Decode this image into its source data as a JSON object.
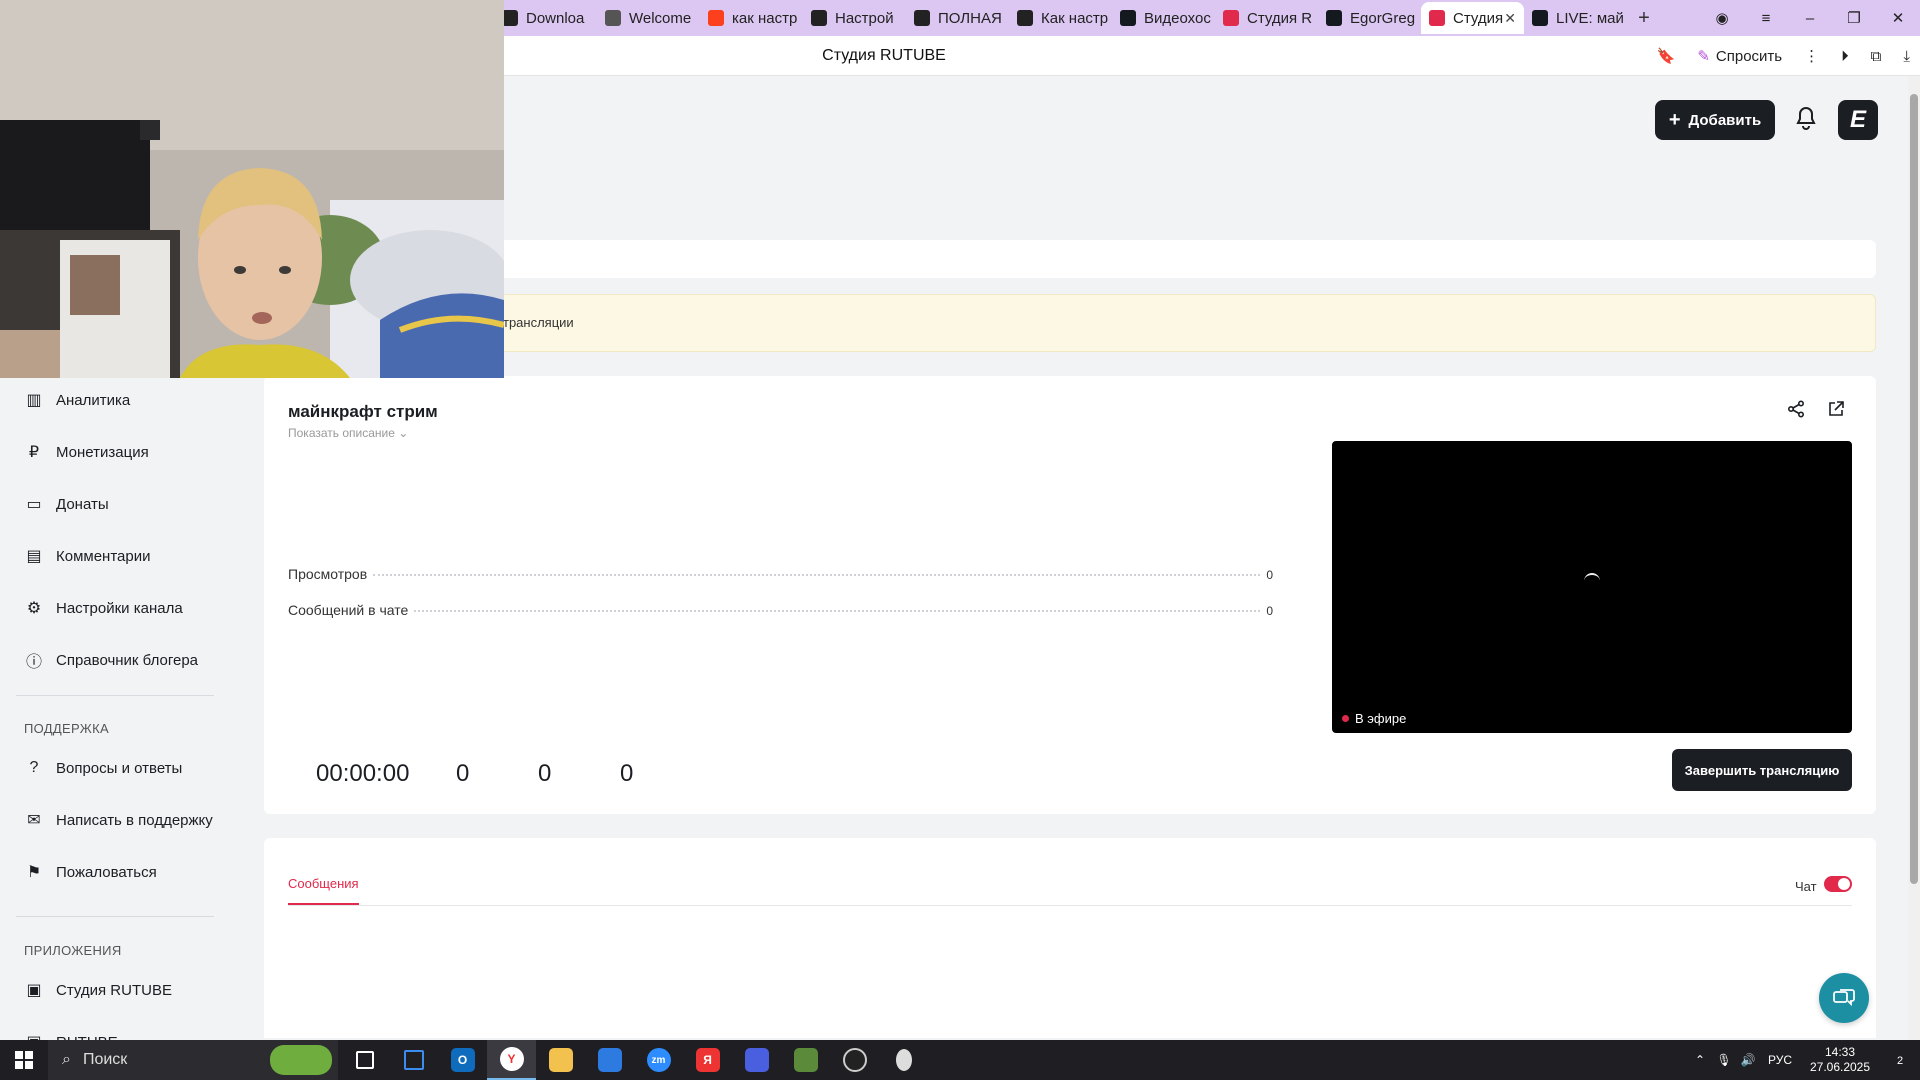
{
  "browser": {
    "tabs": [
      {
        "label": "Downloa",
        "fav": "github-icon",
        "color": "#222222"
      },
      {
        "label": "Welcome",
        "fav": "document-icon",
        "color": "#555555"
      },
      {
        "label": "как настр",
        "fav": "yandex-icon",
        "color": "#fc3f1d"
      },
      {
        "label": "Настрой",
        "fav": "play-icon",
        "color": "#222222"
      },
      {
        "label": "ПОЛНАЯ",
        "fav": "play-icon",
        "color": "#222222"
      },
      {
        "label": "Как настр",
        "fav": "play-icon",
        "color": "#222222"
      },
      {
        "label": "Видеохос",
        "fav": "rutube-icon",
        "color": "#14191f"
      },
      {
        "label": "Студия R",
        "fav": "studio-icon",
        "color": "#e0294b"
      },
      {
        "label": "EgorGreg",
        "fav": "rutube-icon",
        "color": "#14191f"
      },
      {
        "label": "Студия",
        "fav": "studio-icon",
        "color": "#e0294b",
        "active": true
      },
      {
        "label": "LIVE: май",
        "fav": "rutube-icon",
        "color": "#14191f"
      }
    ],
    "page_title": "Студия RUTUBE",
    "ask_label": "Спросить"
  },
  "header": {
    "add_label": "Добавить",
    "avatar_letter": "E"
  },
  "banner": {
    "text": "трансляции"
  },
  "sidebar": {
    "items": [
      {
        "label": "Аналитика",
        "icon": "chart-icon",
        "glyph": "▥"
      },
      {
        "label": "Монетизация",
        "icon": "ruble-icon",
        "glyph": "₽"
      },
      {
        "label": "Донаты",
        "icon": "wallet-icon",
        "glyph": "▭"
      },
      {
        "label": "Комментарии",
        "icon": "comment-icon",
        "glyph": "▤"
      },
      {
        "label": "Настройки канала",
        "icon": "gear-icon",
        "glyph": "⚙"
      },
      {
        "label": "Справочник блогера",
        "icon": "info-icon",
        "glyph": "ⓘ"
      }
    ],
    "support_label": "ПОДДЕРЖКА",
    "support_items": [
      {
        "label": "Вопросы и ответы",
        "icon": "question-icon",
        "glyph": "?"
      },
      {
        "label": "Написать в поддержку",
        "icon": "mail-icon",
        "glyph": "✉"
      },
      {
        "label": "Пожаловаться",
        "icon": "flag-icon",
        "glyph": "⚑"
      }
    ],
    "apps_label": "ПРИЛОЖЕНИЯ",
    "apps_items": [
      {
        "label": "Студия RUTUBE",
        "icon": "studio-app-icon",
        "glyph": "▣"
      },
      {
        "label": "RUTUBE",
        "icon": "rutube-app-icon",
        "glyph": "▣"
      }
    ]
  },
  "stream": {
    "title": "майнкрафт стрим",
    "show_description": "Показать описание",
    "views_label": "Просмотров",
    "views_value": "0",
    "chat_messages_label": "Сообщений в чате",
    "chat_messages_value": "0",
    "duration": "00:00:00",
    "counter_1": "0",
    "counter_2": "0",
    "counter_3": "0",
    "live_label": "В эфире",
    "end_button": "Завершить трансляцию"
  },
  "chat": {
    "tab_messages": "Сообщения",
    "toggle_label": "Чат",
    "toggle_on": true
  },
  "taskbar": {
    "search_placeholder": "Поиск",
    "lang": "РУС",
    "time": "14:33",
    "date": "27.06.2025",
    "notifications": "2"
  }
}
